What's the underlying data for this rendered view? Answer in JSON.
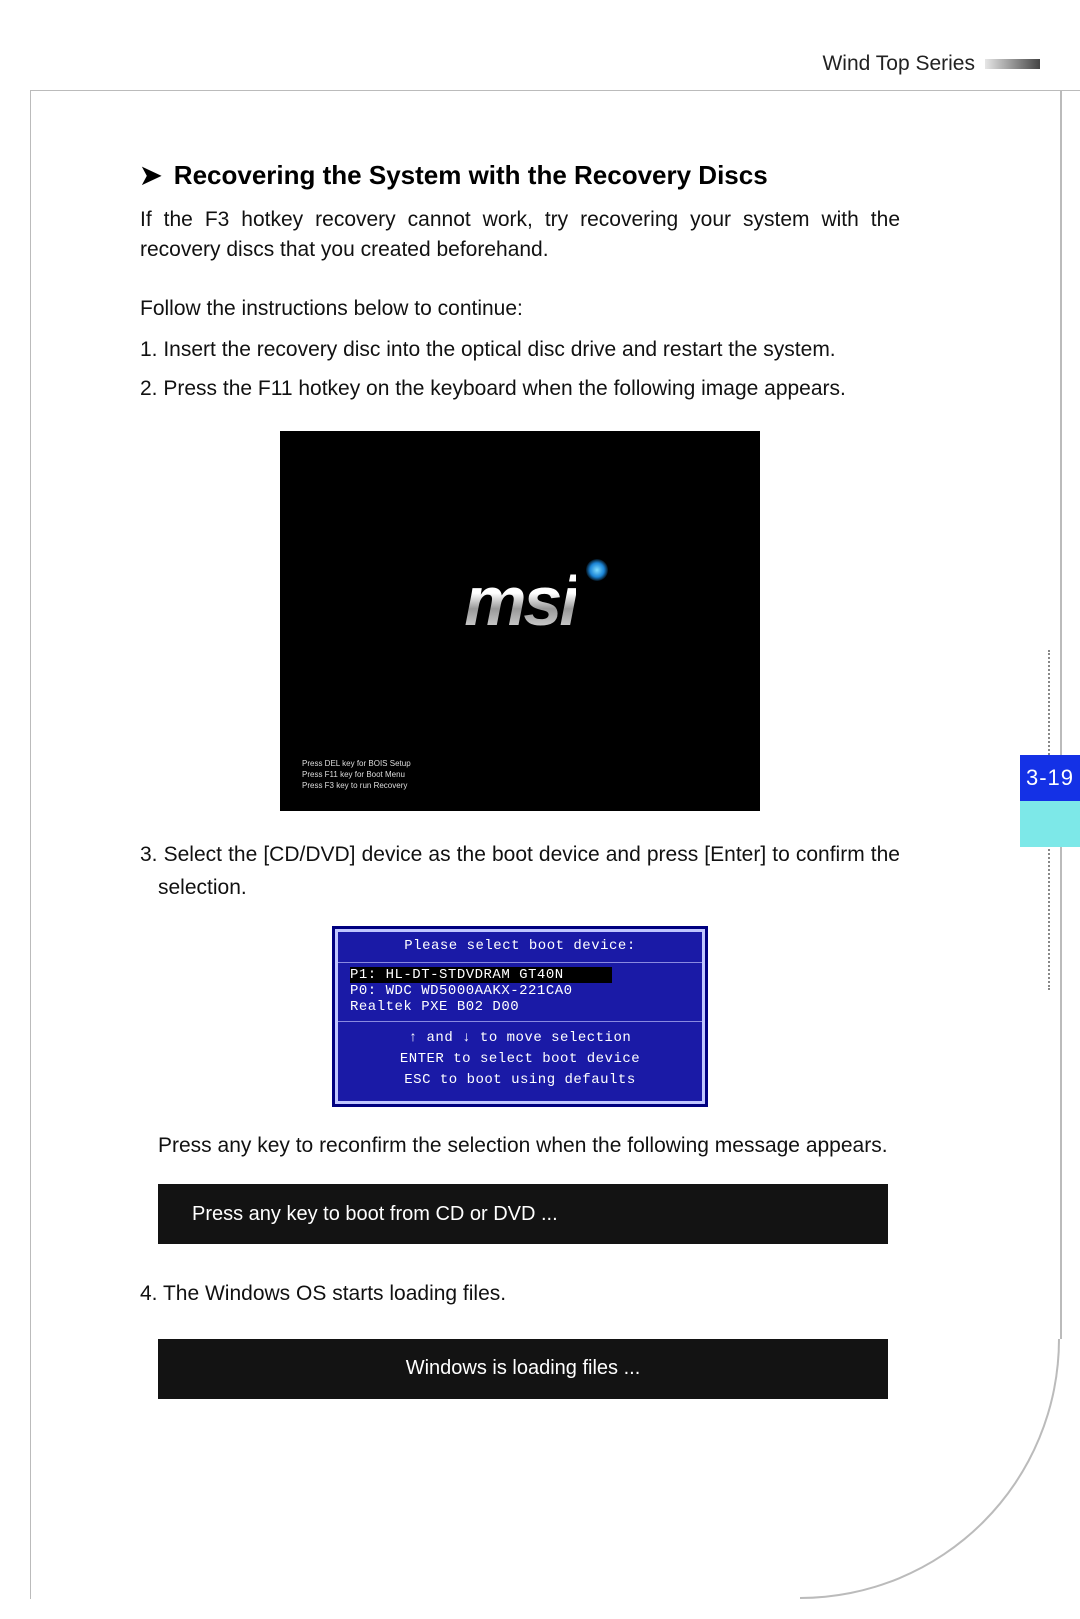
{
  "header": {
    "series": "Wind Top Series"
  },
  "section": {
    "title": "Recovering the System with the Recovery Discs",
    "intro": "If the F3 hotkey recovery cannot work, try recovering your system with the recovery discs that you created beforehand.",
    "follow": "Follow the instructions below to continue:"
  },
  "steps": {
    "s1": "1. Insert the recovery disc into the optical disc drive and restart the system.",
    "s2": "2. Press the F11 hotkey on the keyboard when the following image appears.",
    "s3": "3. Select the [CD/DVD] device as the boot device and press [Enter] to confirm the selection.",
    "s3b": "Press any key to reconfirm the selection when the following message appears.",
    "s4": "4. The Windows OS starts loading files."
  },
  "bios": {
    "logo": "msi",
    "line1": "Press DEL key for BOIS Setup",
    "line2": "Press F11 key for Boot Menu",
    "line3": "Press F3 key to run Recovery"
  },
  "boot_menu": {
    "title": "Please select boot device:",
    "opt1": "P1: HL-DT-STDVDRAM GT40N",
    "opt2": "P0: WDC WD5000AAKX-221CA0",
    "opt3": "Realtek PXE B02 D00",
    "help1": "↑ and ↓ to move selection",
    "help2": "ENTER to select boot device",
    "help3": "ESC to boot using defaults"
  },
  "bars": {
    "boot_cd": "Press any key to boot from CD or DVD ...",
    "loading": "Windows is loading files ..."
  },
  "page_number": "3-19"
}
